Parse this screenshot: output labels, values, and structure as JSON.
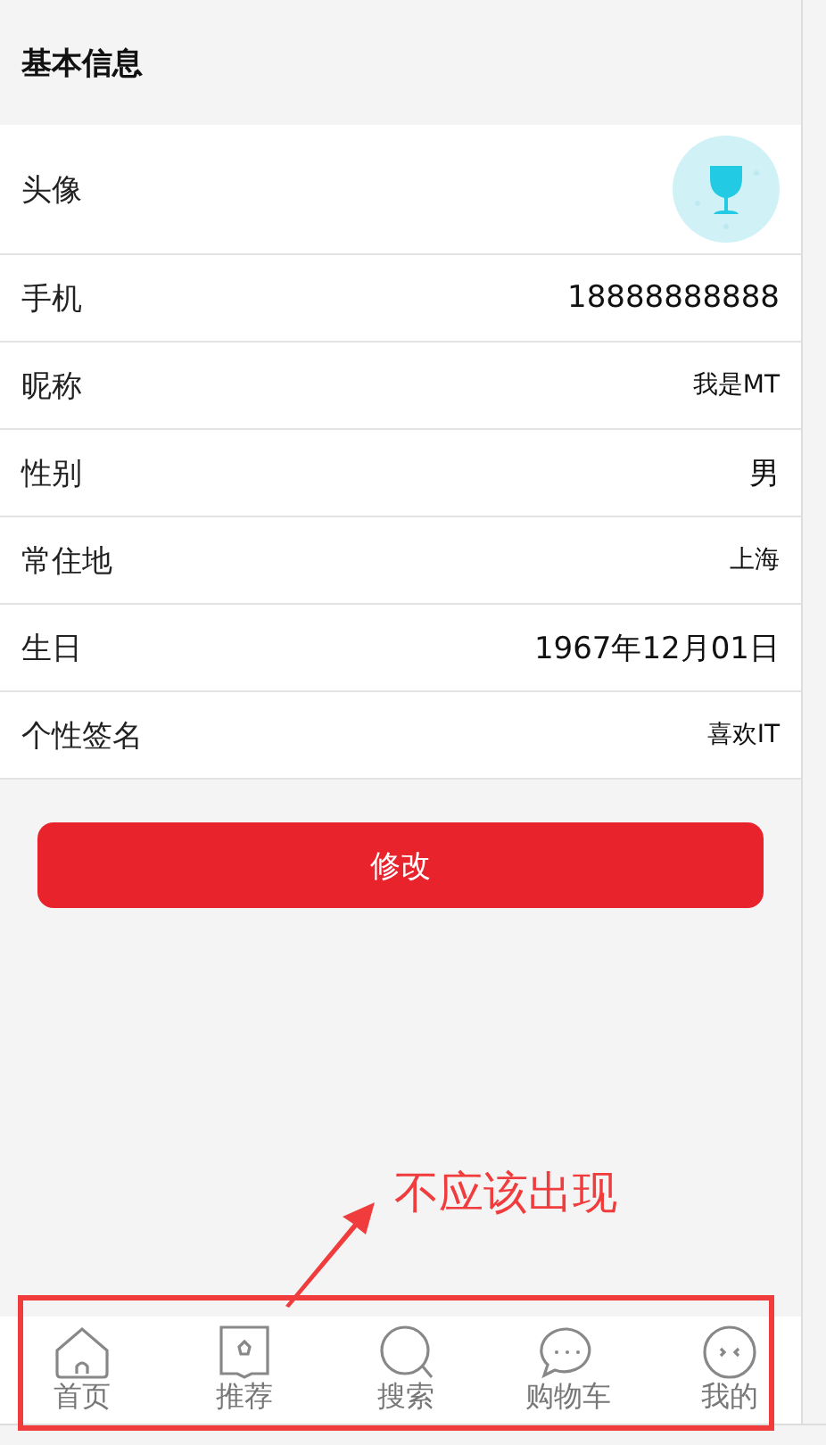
{
  "header": {
    "title": "基本信息"
  },
  "rows": [
    {
      "kind": "avatar",
      "label": "头像"
    },
    {
      "kind": "text",
      "label": "手机",
      "value": "18888888888",
      "large": true
    },
    {
      "kind": "text",
      "label": "昵称",
      "value": "我是MT",
      "large": false
    },
    {
      "kind": "text",
      "label": "性别",
      "value": "男",
      "large": true
    },
    {
      "kind": "text",
      "label": "常住地",
      "value": "上海",
      "large": false
    },
    {
      "kind": "text",
      "label": "生日",
      "value": "1967年12月01日",
      "large": true
    },
    {
      "kind": "text",
      "label": "个性签名",
      "value": "喜欢IT",
      "large": false
    }
  ],
  "button": {
    "label": "修改"
  },
  "annotation": {
    "text": "不应该出现"
  },
  "nav": [
    {
      "label": "首页"
    },
    {
      "label": "推荐"
    },
    {
      "label": "搜索"
    },
    {
      "label": "购物车"
    },
    {
      "label": "我的"
    }
  ]
}
